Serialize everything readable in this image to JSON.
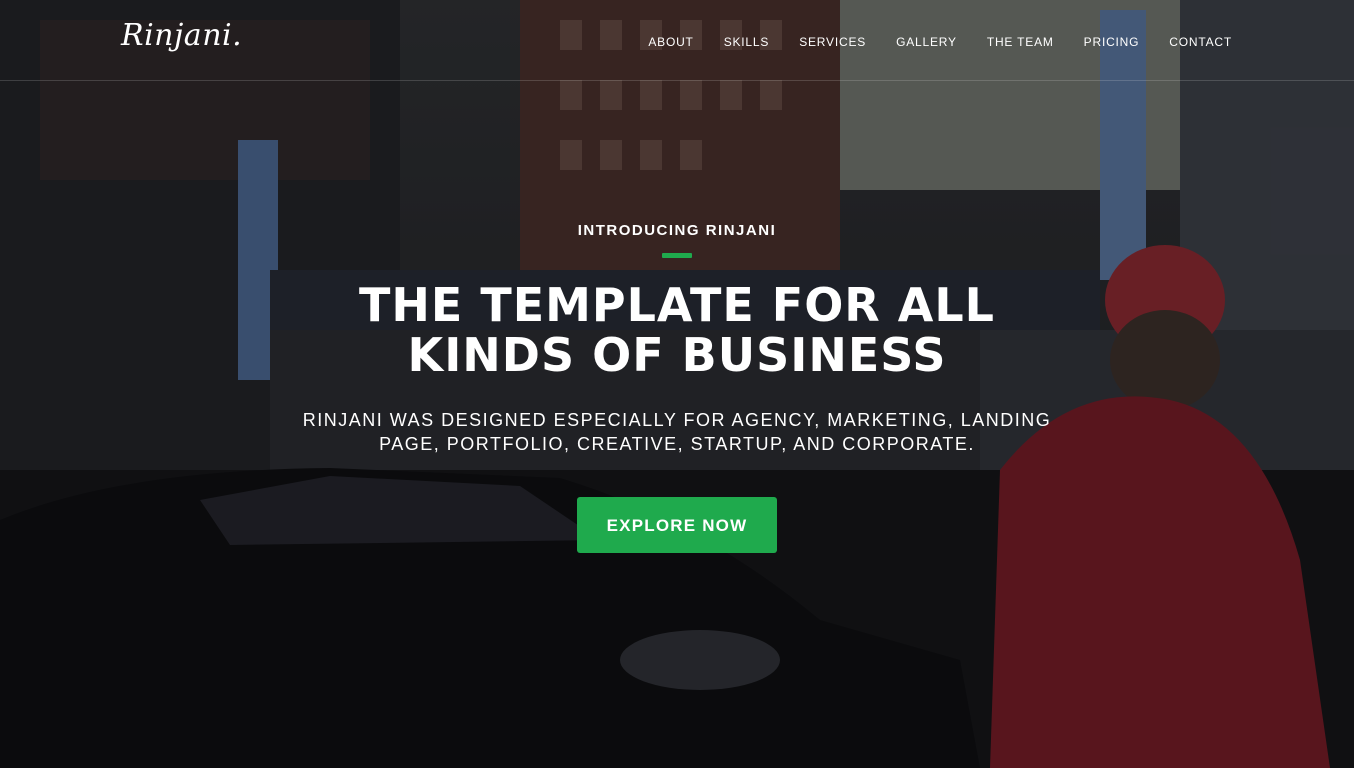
{
  "brand": {
    "logo_text": "Rinjani."
  },
  "nav": {
    "items": [
      {
        "label": "ABOUT"
      },
      {
        "label": "SKILLS"
      },
      {
        "label": "SERVICES"
      },
      {
        "label": "GALLERY"
      },
      {
        "label": "THE TEAM"
      },
      {
        "label": "PRICING"
      },
      {
        "label": "CONTACT"
      }
    ]
  },
  "hero": {
    "intro": "INTRODUCING RINJANI",
    "headline_line1": "THE TEMPLATE FOR ALL",
    "headline_line2": "KINDS OF BUSINESS",
    "subtext_line1": "RINJANI WAS DESIGNED ESPECIALLY FOR AGENCY, MARKETING, LANDING",
    "subtext_line2": "PAGE, PORTFOLIO, CREATIVE, STARTUP, AND CORPORATE.",
    "cta_label": "EXPLORE NOW"
  },
  "colors": {
    "accent": "#1faa4d",
    "overlay": "#000000"
  }
}
